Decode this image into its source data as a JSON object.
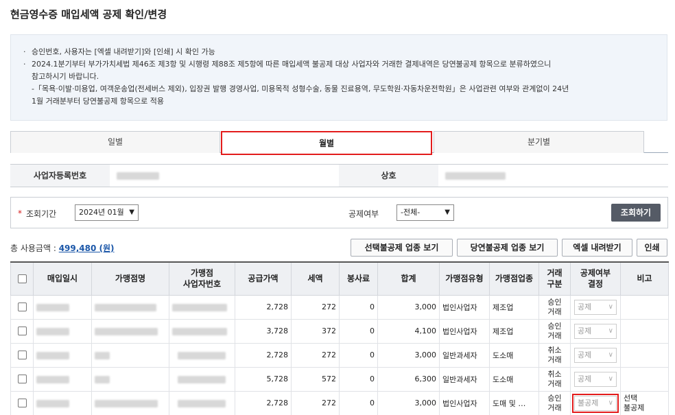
{
  "page": {
    "title": "현금영수증 매입세액 공제 확인/변경"
  },
  "notice": {
    "lines": [
      "승인번호, 사용자는 [엑셀 내려받기]와 [인쇄] 시 확인 가능",
      "2024.1분기부터 부가가치세법 제46조 제3항 및 시행령 제88조 제5항에 따른 매입세액 불공제 대상 사업자와 거래한 결제내역은 당연불공제 항목으로 분류하였으니",
      "참고하시기 바랍니다.",
      "-「목욕·이발·미용업, 여객운송업(전세버스 제외), 입장권 발행 경영사업, 미용목적 성형수술, 동물 진료용역, 무도학원·자동차운전학원」은 사업관련 여부와 관계없이 24년",
      "1월 거래분부터 당연불공제 항목으로 적용"
    ]
  },
  "tabs": {
    "day": "일별",
    "month": "월별",
    "quarter": "분기별"
  },
  "info": {
    "biz_no_label": "사업자등록번호",
    "name_label": "상호"
  },
  "search": {
    "period_label": "조회기간",
    "period_value": "2024년 01월",
    "deduct_label": "공제여부",
    "deduct_value": "-전체-",
    "query_button": "조회하기"
  },
  "summary": {
    "label": "총 사용금액 :",
    "amount": "499,480 (원)"
  },
  "actions": {
    "selected_nondeduct": "선택불공제 업종 보기",
    "auto_nondeduct": "당연불공제 업종 보기",
    "excel": "엑셀 내려받기",
    "print": "인쇄"
  },
  "table": {
    "headers": {
      "date": "매입일시",
      "merchant": "가맹점명",
      "merchant_biz_no_1": "가맹점",
      "merchant_biz_no_2": "사업자번호",
      "supply": "공급가액",
      "tax": "세액",
      "tip": "봉사료",
      "total": "합계",
      "merchant_type": "가맹점유형",
      "merchant_industry": "가맹점업종",
      "trade_type_1": "거래",
      "trade_type_2": "구분",
      "deduct_1": "공제여부",
      "deduct_2": "결정",
      "note": "비고"
    },
    "rows": [
      {
        "supply": "2,728",
        "tax": "272",
        "tip": "0",
        "total": "3,000",
        "type": "법인사업자",
        "industry": "제조업",
        "trade1": "승인",
        "trade2": "거래",
        "deduct": "공제",
        "note1": "",
        "note2": ""
      },
      {
        "supply": "3,728",
        "tax": "372",
        "tip": "0",
        "total": "4,100",
        "type": "법인사업자",
        "industry": "제조업",
        "trade1": "승인",
        "trade2": "거래",
        "deduct": "공제",
        "note1": "",
        "note2": ""
      },
      {
        "supply": "2,728",
        "tax": "272",
        "tip": "0",
        "total": "3,000",
        "type": "일반과세자",
        "industry": "도소매",
        "trade1": "취소",
        "trade2": "거래",
        "deduct": "공제",
        "note1": "",
        "note2": ""
      },
      {
        "supply": "5,728",
        "tax": "572",
        "tip": "0",
        "total": "6,300",
        "type": "일반과세자",
        "industry": "도소매",
        "trade1": "취소",
        "trade2": "거래",
        "deduct": "공제",
        "note1": "",
        "note2": ""
      },
      {
        "supply": "2,728",
        "tax": "272",
        "tip": "0",
        "total": "3,000",
        "type": "법인사업자",
        "industry": "도매 및 …",
        "trade1": "승인",
        "trade2": "거래",
        "deduct": "불공제",
        "note1": "선택",
        "note2": "불공제"
      }
    ]
  }
}
